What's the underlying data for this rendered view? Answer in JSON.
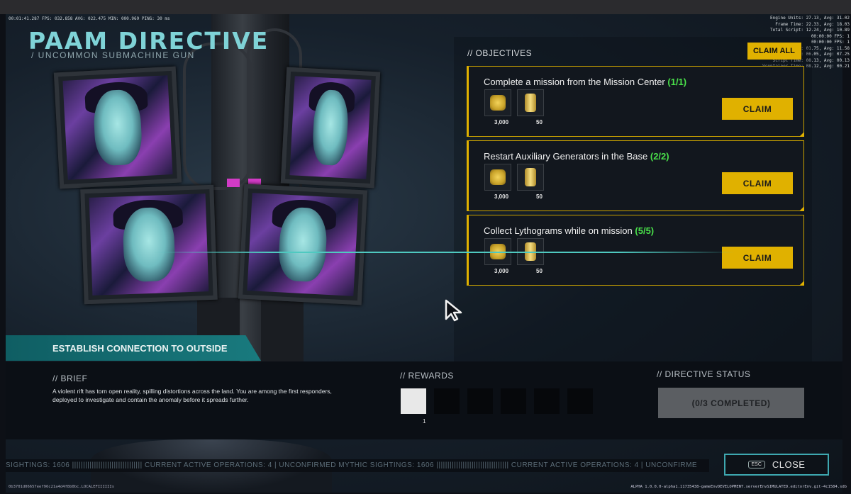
{
  "debug": {
    "top_left": "00:01:41.287 FPS: 032.858 AVG: 022.475 MIN: 000.969 PING: 30 ms",
    "top_right": "Engine Units: 27.13, Avg: 31.02\nFrame Time: 22.33, Avg: 18.03\nTotal Script: 12.24, Avg: 10.89\n00:00:00 FPS: 1\n00:00:00 FPS: 1\nSimulation: 01.75, Avg: 11.58\nRender Time: 06.05, Avg: 07.25\nScript Time: 08.13, Avg: 00.13\nVcontainer Time: 08.12, Avg: 00.21",
    "footer_left": "0b3701d06657eef96c21a4d4f8b0bc.LOCALEFIIIIIIs",
    "footer_right": "ALPHA 1.0.0.0-alpha1.11735438-gameEnvDEVELOPMENT.serverEnvSIMULATED.editorEnv.git-4c1584.sdb"
  },
  "title": "PAAM DIRECTIVE",
  "subtitle": "/ UNCOMMON SUBMACHINE GUN",
  "objectives": {
    "header": "// OBJECTIVES",
    "claim_all_label": "CLAIM ALL",
    "items": [
      {
        "title": "Complete a mission from the Mission Center",
        "progress": "(1/1)",
        "reward1_icon": "credit-coin-icon",
        "reward1_value": "3,000",
        "reward2_icon": "lythogram-jar-icon",
        "reward2_value": "50",
        "claim_label": "CLAIM"
      },
      {
        "title": "Restart Auxiliary Generators in the Base",
        "progress": "(2/2)",
        "reward1_icon": "credit-coin-icon",
        "reward1_value": "3,000",
        "reward2_icon": "lythogram-jar-icon",
        "reward2_value": "50",
        "claim_label": "CLAIM"
      },
      {
        "title": "Collect Lythograms while on mission",
        "progress": "(5/5)",
        "reward1_icon": "credit-coin-icon",
        "reward1_value": "3,000",
        "reward2_icon": "lythogram-jar-icon",
        "reward2_value": "50",
        "claim_label": "CLAIM"
      }
    ]
  },
  "mission_banner": "ESTABLISH CONNECTION TO OUTSIDE",
  "brief": {
    "header": "// BRIEF",
    "text": "A violent rift has torn open reality, spilling distortions across the land. You are among the first responders, deployed to investigate and contain the anomaly before it spreads further."
  },
  "rewards": {
    "header": "// REWARDS",
    "first_slot_count": "1",
    "slot_count": 6
  },
  "directive_status": {
    "header": "// DIRECTIVE STATUS",
    "value": "(0/3 COMPLETED)"
  },
  "ticker": "SIGHTINGS: 1606   ||||||||||||||||||||||||||||||||   CURRENT ACTIVE OPERATIONS: 4 | UNCONFIRMED MYTHIC SIGHTINGS: 1606   |||||||||||||||||||||||||||||||||   CURRENT ACTIVE OPERATIONS: 4 | UNCONFIRME",
  "close": {
    "key": "ESC",
    "label": "CLOSE"
  },
  "colors": {
    "accent_gold": "#e0b100",
    "accent_teal": "#3ea8b0",
    "progress_green": "#49e04a"
  }
}
